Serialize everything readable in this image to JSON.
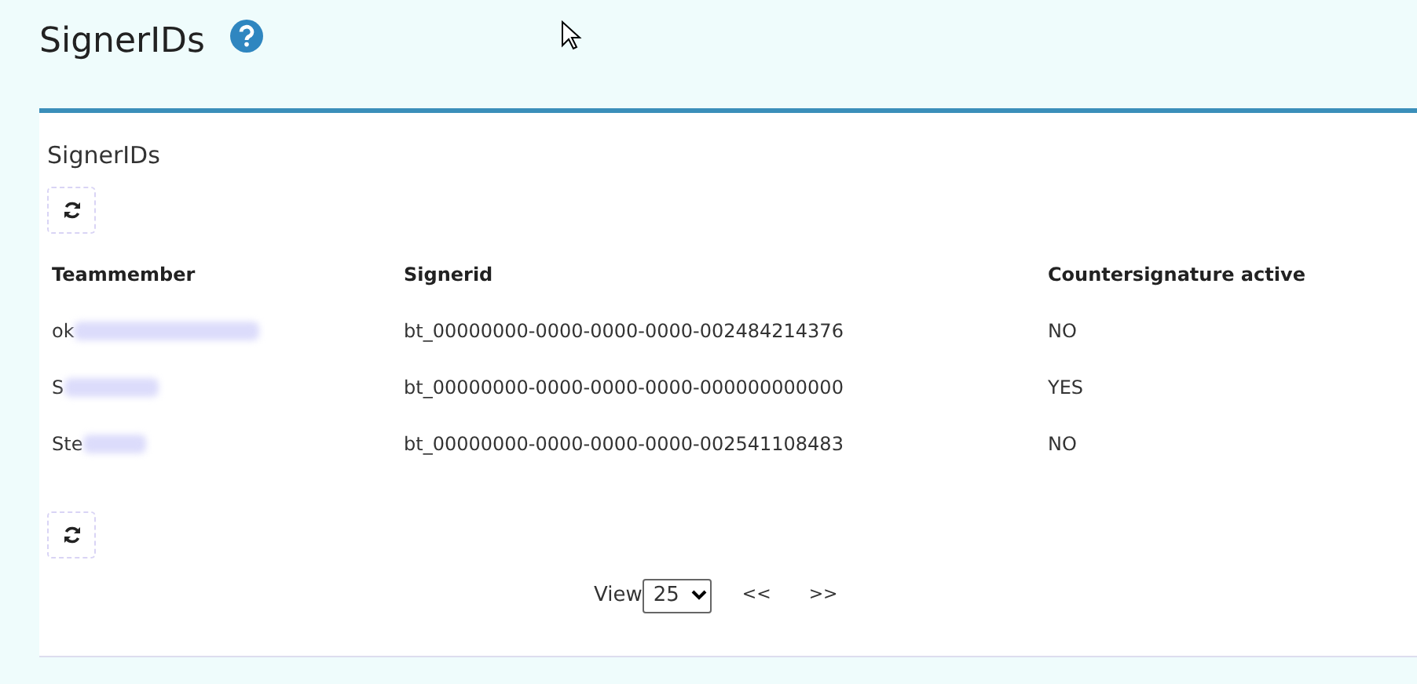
{
  "page": {
    "title": "SignerIDs"
  },
  "card": {
    "title": "SignerIDs"
  },
  "table": {
    "columns": [
      "Teammember",
      "Signerid",
      "Countersignature active"
    ],
    "rows": [
      {
        "cells": [
          "ok",
          "bt_00000000-0000-0000-0000-002484214376",
          "NO"
        ],
        "redacted": true
      },
      {
        "cells": [
          "S",
          "bt_00000000-0000-0000-0000-000000000000",
          "YES"
        ],
        "redacted": true
      },
      {
        "cells": [
          "Ste",
          "bt_00000000-0000-0000-0000-002541108483",
          "NO"
        ],
        "redacted": true
      }
    ]
  },
  "pager": {
    "label": "View",
    "page_size": "25",
    "prev": "<<",
    "next": ">>"
  }
}
